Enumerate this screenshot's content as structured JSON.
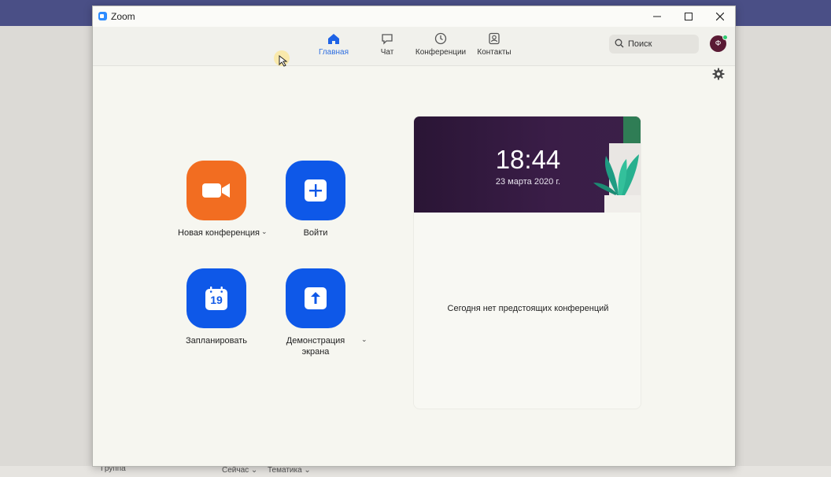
{
  "window": {
    "title": "Zoom"
  },
  "window_controls": {
    "minimize": "—",
    "maximize": "☐",
    "close": "✕"
  },
  "nav": {
    "items": [
      {
        "label": "Главная",
        "icon": "home-icon",
        "active": true
      },
      {
        "label": "Чат",
        "icon": "chat-icon",
        "active": false
      },
      {
        "label": "Конференции",
        "icon": "clock-icon",
        "active": false
      },
      {
        "label": "Контакты",
        "icon": "contacts-icon",
        "active": false
      }
    ]
  },
  "search": {
    "placeholder": "Поиск"
  },
  "user": {
    "avatar_letter": "Ф"
  },
  "actions": {
    "new_meeting": {
      "label": "Новая конференция",
      "icon": "video-camera-icon"
    },
    "join": {
      "label": "Войти",
      "icon": "plus-icon"
    },
    "schedule": {
      "label": "Запланировать",
      "icon": "calendar-icon",
      "day": "19"
    },
    "share_screen": {
      "label_line1": "Демонстрация",
      "label_line2": "экрана",
      "icon": "upload-arrow-icon"
    }
  },
  "meetings_card": {
    "time": "18:44",
    "date": "23 марта 2020 г.",
    "empty_text": "Сегодня нет предстоящих конференций"
  },
  "background": {
    "tab1": "Сейчас ⌄",
    "tab2": "Тематика ⌄",
    "left_text": "Группа"
  },
  "colors": {
    "accent": "#0e58e8",
    "orange": "#f26d21",
    "nav_active": "#2f6fe0",
    "banner": "#2a1535"
  }
}
